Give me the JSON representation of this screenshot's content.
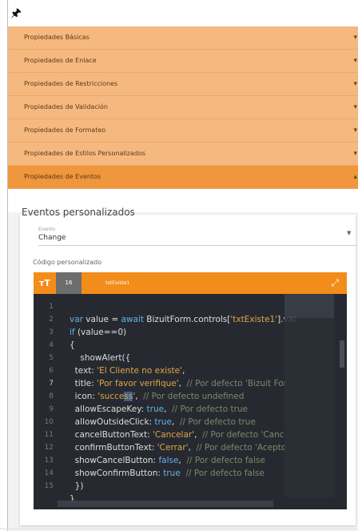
{
  "pin_icon": "pin-icon",
  "accordion": [
    {
      "label": "Propiedades Básicas",
      "expanded": false
    },
    {
      "label": "Propiedades de Enlace",
      "expanded": false
    },
    {
      "label": "Propiedades de Restricciones",
      "expanded": false
    },
    {
      "label": "Propiedades de Validación",
      "expanded": false
    },
    {
      "label": "Propiedades de Formateo",
      "expanded": false
    },
    {
      "label": "Propiedades de Estilos Personalizados",
      "expanded": false
    },
    {
      "label": "Propiedades de Eventos",
      "expanded": true
    }
  ],
  "events_panel": {
    "title": "Eventos personalizados",
    "event_field_label": "Evento",
    "event_value": "Change",
    "code_label": "Código personalizado"
  },
  "editor_toolbar": {
    "font_size": "16",
    "control_name": "txtExiste1"
  },
  "editor": {
    "first_line_partial": "var value = await BizuitForm.controls['txtExiste1'].val",
    "lines": [
      {
        "n": "2",
        "text": "if (value==0)"
      },
      {
        "n": "3",
        "text": "{"
      },
      {
        "n": "4",
        "text": "    showAlert({"
      },
      {
        "n": "5",
        "text": "  text: 'El Cliente no existe',"
      },
      {
        "n": "6",
        "text": "  title: 'Por favor verifique',  // Por defecto 'Bizuit For"
      },
      {
        "n": "7",
        "text": "  icon: 'success',  // Por defecto undefined"
      },
      {
        "n": "8",
        "text": "  allowEscapeKey: true,  // Por defecto true"
      },
      {
        "n": "9",
        "text": "  allowOutsideClick: true,  // Por defecto true"
      },
      {
        "n": "10",
        "text": "  cancelButtonText: 'Cancelar',  // Por defecto 'Canc"
      },
      {
        "n": "11",
        "text": "  confirmButtonText: 'Cerrar',  // Por defecto 'Acepto"
      },
      {
        "n": "12",
        "text": "  showCancelButton: false,  // Por defecto false"
      },
      {
        "n": "13",
        "text": "  showConfirmButton: true  // Por defecto false"
      },
      {
        "n": "14",
        "text": "  })"
      },
      {
        "n": "15",
        "text": "}"
      }
    ]
  },
  "colors": {
    "accordion_bg": "#f5b97f",
    "accordion_active_bg": "#f0963d",
    "toolbar_bg": "#f28c1a",
    "editor_bg": "#262a30"
  }
}
